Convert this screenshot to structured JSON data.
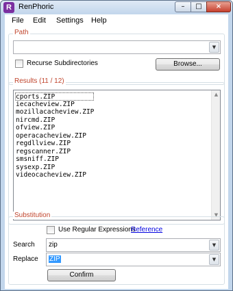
{
  "window": {
    "title": "RenPhoric",
    "app_icon_letter": "R"
  },
  "titlebar_buttons": {
    "minimize": "–",
    "maximize": "□",
    "close": "×"
  },
  "menu": [
    "File",
    "Edit",
    "Settings",
    "Help"
  ],
  "path_group": {
    "title": "Path",
    "path_value": "",
    "recurse_label": "Recurse Subdirectories",
    "recurse_checked": false,
    "browse_label": "Browse..."
  },
  "results_group": {
    "title": "Results (11 / 12)",
    "files": [
      "cports.ZIP",
      "iecacheview.ZIP",
      "mozillacacheview.ZIP",
      "nircmd.ZIP",
      "ofview.ZIP",
      "operacacheview.ZIP",
      "regdllview.ZIP",
      "regscanner.ZIP",
      "smsniff.ZIP",
      "sysexp.ZIP",
      "videocacheview.ZIP"
    ]
  },
  "substitution_group": {
    "title": "Substitution",
    "regex_label": "Use Regular Expressions",
    "regex_checked": false,
    "reference_link": "Reference",
    "search_label": "Search",
    "search_value": "zip",
    "replace_label": "Replace",
    "replace_value": "ZIP",
    "confirm_label": "Confirm"
  },
  "icons": {
    "dropdown": "chevron-down-icon",
    "scroll_up": "arrow-up-icon",
    "scroll_down": "arrow-down-icon"
  }
}
